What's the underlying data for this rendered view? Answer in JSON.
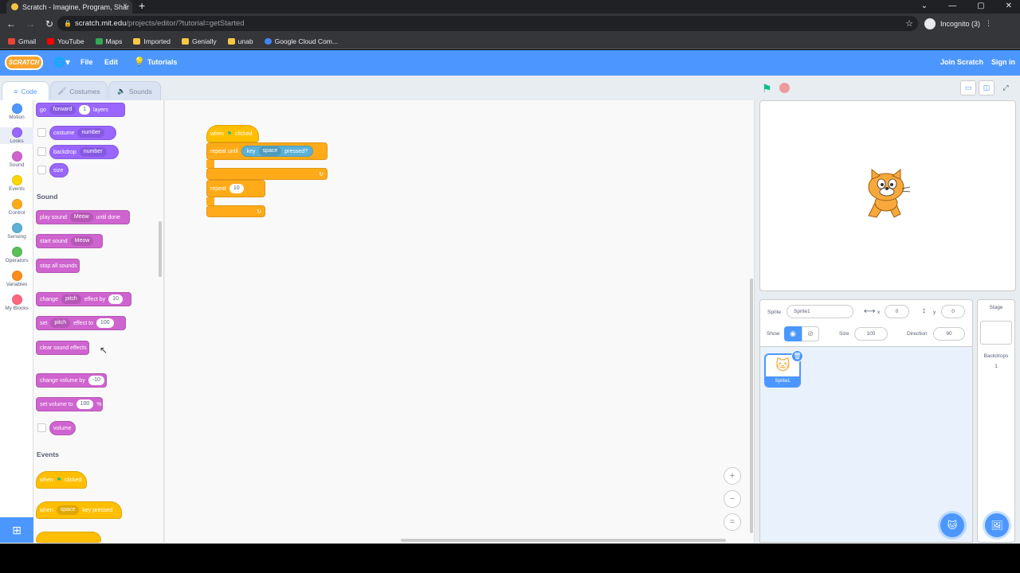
{
  "browser": {
    "tab_title": "Scratch - Imagine, Program, Shar",
    "url_host": "scratch.mit.edu",
    "url_path": "/projects/editor/?tutorial=getStarted",
    "profile": "Incognito (3)",
    "bookmarks": [
      "Gmail",
      "YouTube",
      "Maps",
      "Imported",
      "Genially",
      "unab",
      "Google Cloud Com..."
    ]
  },
  "menu": {
    "logo": "SCRATCH",
    "file": "File",
    "edit": "Edit",
    "tutorials": "Tutorials",
    "join": "Join Scratch",
    "signin": "Sign in"
  },
  "tabs": {
    "code": "Code",
    "costumes": "Costumes",
    "sounds": "Sounds"
  },
  "categories": [
    {
      "label": "Motion",
      "color": "#4c97ff"
    },
    {
      "label": "Looks",
      "color": "#9966ff"
    },
    {
      "label": "Sound",
      "color": "#cf63cf"
    },
    {
      "label": "Events",
      "color": "#ffbf00"
    },
    {
      "label": "Control",
      "color": "#ffab19"
    },
    {
      "label": "Sensing",
      "color": "#5cb1d6"
    },
    {
      "label": "Operators",
      "color": "#59c059"
    },
    {
      "label": "Variables",
      "color": "#ff8c1a"
    },
    {
      "label": "My Blocks",
      "color": "#ff6680"
    }
  ],
  "palette": {
    "go": "go",
    "forward": "forward",
    "one": "1",
    "layers": "layers",
    "costume": "costume",
    "number": "number",
    "backdrop": "backdrop",
    "size": "size",
    "sound_header": "Sound",
    "play_sound": "play sound",
    "meow": "Meow",
    "until_done": "until done",
    "start_sound": "start sound",
    "stop_all": "stop all sounds",
    "change": "change",
    "pitch": "pitch",
    "effect_by": "effect by",
    "ten": "10",
    "set": "set",
    "effect_to": "effect to",
    "hundred": "100",
    "clear_effects": "clear sound effects",
    "change_volume": "change volume by",
    "minus_ten": "-10",
    "set_volume": "set volume to",
    "percent": "%",
    "volume": "volume",
    "events_header": "Events",
    "when": "when",
    "clicked": "clicked",
    "space": "space",
    "key_pressed": "key pressed"
  },
  "script": {
    "when": "when",
    "clicked": "clicked",
    "repeat_until": "repeat until",
    "key": "key",
    "space": "space",
    "pressed": "pressed?",
    "repeat": "repeat",
    "repeat_count": "10"
  },
  "sprite": {
    "sprite_label": "Sprite",
    "sprite_name": "Sprite1",
    "x_label": "x",
    "x": "0",
    "y_label": "y",
    "y": "0",
    "show_label": "Show",
    "size_label": "Size",
    "size": "100",
    "direction_label": "Direction",
    "direction": "90",
    "thumb_name": "Sprite1"
  },
  "stage": {
    "label": "Stage",
    "backdrops_label": "Backdrops",
    "backdrops_count": "1"
  }
}
